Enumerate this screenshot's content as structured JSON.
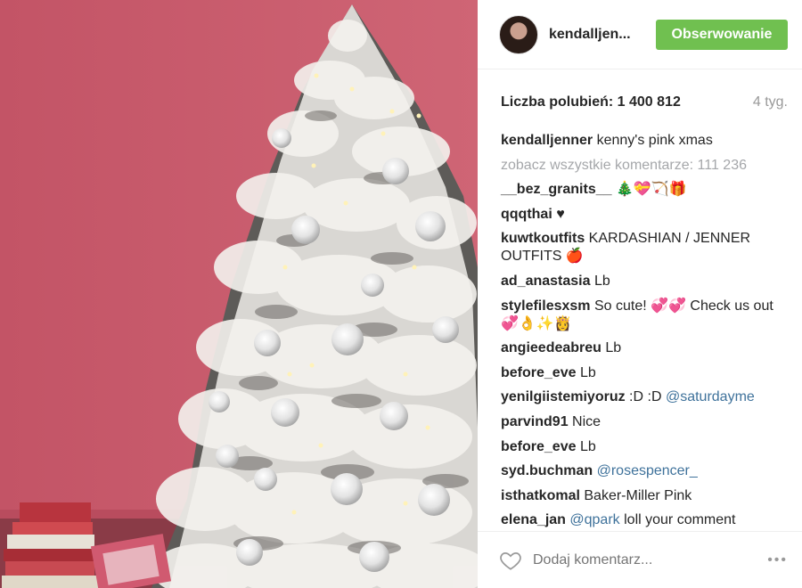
{
  "photo": {
    "alt": "Photo of a flocked Christmas tree against a pink wall"
  },
  "header": {
    "username": "kendalljen...",
    "follow_label": "Obserwowanie",
    "follow_color": "#70c050"
  },
  "stats": {
    "likes": "Liczba polubień: 1 400 812",
    "time": "4 tyg."
  },
  "caption": {
    "user": "kendalljenner",
    "text": "kenny's pink xmas"
  },
  "view_all": "zobacz wszystkie komentarze: 111 236",
  "comments": [
    {
      "user": "__bez_granits__",
      "text": "🎄💝🏹🎁"
    },
    {
      "user": "qqqthai",
      "text": "♥"
    },
    {
      "user": "kuwtkoutfits",
      "text": "KARDASHIAN / JENNER OUTFITS 🍎"
    },
    {
      "user": "ad_anastasia",
      "text": "Lb"
    },
    {
      "user": "stylefilesxsm",
      "text": "So cute! 💞💞 Check us out 💞👌✨👸"
    },
    {
      "user": "angieedeabreu",
      "text": "Lb"
    },
    {
      "user": "before_eve",
      "text": "Lb"
    },
    {
      "user": "yenilgiistemiyoruz",
      "text": ":D :D",
      "mention": "@saturdayme"
    },
    {
      "user": "parvind91",
      "text": "Nice"
    },
    {
      "user": "before_eve",
      "text": "Lb"
    },
    {
      "user": "syd.buchman",
      "text": "",
      "mention": "@rosespencer_"
    },
    {
      "user": "isthatkomal",
      "text": "Baker-Miller Pink"
    },
    {
      "user": "elena_jan",
      "text": "",
      "mention": "@qpark",
      "after": "loll your comment"
    }
  ],
  "footer": {
    "placeholder": "Dodaj komentarz...",
    "more": "•••",
    "icons": {
      "like": "heart-icon",
      "more": "more-icon"
    }
  }
}
